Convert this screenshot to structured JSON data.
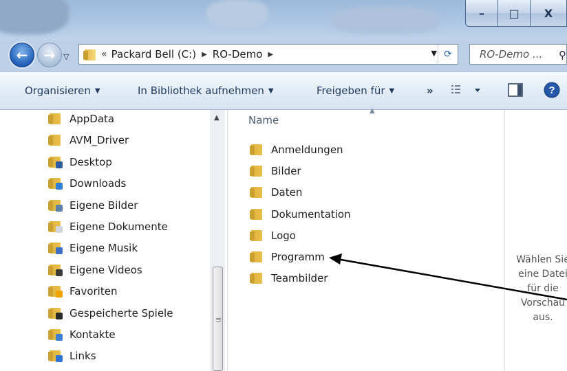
{
  "window": {
    "minimize_label": "–",
    "maximize_label": "□",
    "close_label": "X"
  },
  "address": {
    "chevron": "«",
    "crumbs": [
      "Packard Bell (C:)",
      "RO-Demo"
    ]
  },
  "search": {
    "placeholder": "RO-Demo ..."
  },
  "toolbar": {
    "organize": "Organisieren",
    "include_library": "In Bibliothek aufnehmen",
    "share_with": "Freigeben für",
    "more": "»"
  },
  "nav_items": [
    {
      "label": "AppData",
      "icon": "folder-icon"
    },
    {
      "label": "AVM_Driver",
      "icon": "folder-icon"
    },
    {
      "label": "Desktop",
      "icon": "desktop-folder-icon"
    },
    {
      "label": "Downloads",
      "icon": "downloads-folder-icon"
    },
    {
      "label": "Eigene Bilder",
      "icon": "pictures-folder-icon"
    },
    {
      "label": "Eigene Dokumente",
      "icon": "documents-folder-icon"
    },
    {
      "label": "Eigene Musik",
      "icon": "music-folder-icon"
    },
    {
      "label": "Eigene Videos",
      "icon": "videos-folder-icon"
    },
    {
      "label": "Favoriten",
      "icon": "favorites-folder-icon"
    },
    {
      "label": "Gespeicherte Spiele",
      "icon": "saved-games-folder-icon"
    },
    {
      "label": "Kontakte",
      "icon": "contacts-folder-icon"
    },
    {
      "label": "Links",
      "icon": "links-folder-icon"
    }
  ],
  "content": {
    "column_name": "Name",
    "files": [
      "Anmeldungen",
      "Bilder",
      "Daten",
      "Dokumentation",
      "Logo",
      "Programm",
      "Teambilder"
    ]
  },
  "preview": {
    "lines": [
      "Wählen Sie",
      "eine Datei",
      "für die",
      "Vorschau",
      "aus."
    ]
  },
  "colors": {
    "folder": "#e8bd4a",
    "arrow": "#000000",
    "accent": "#1e395b"
  }
}
